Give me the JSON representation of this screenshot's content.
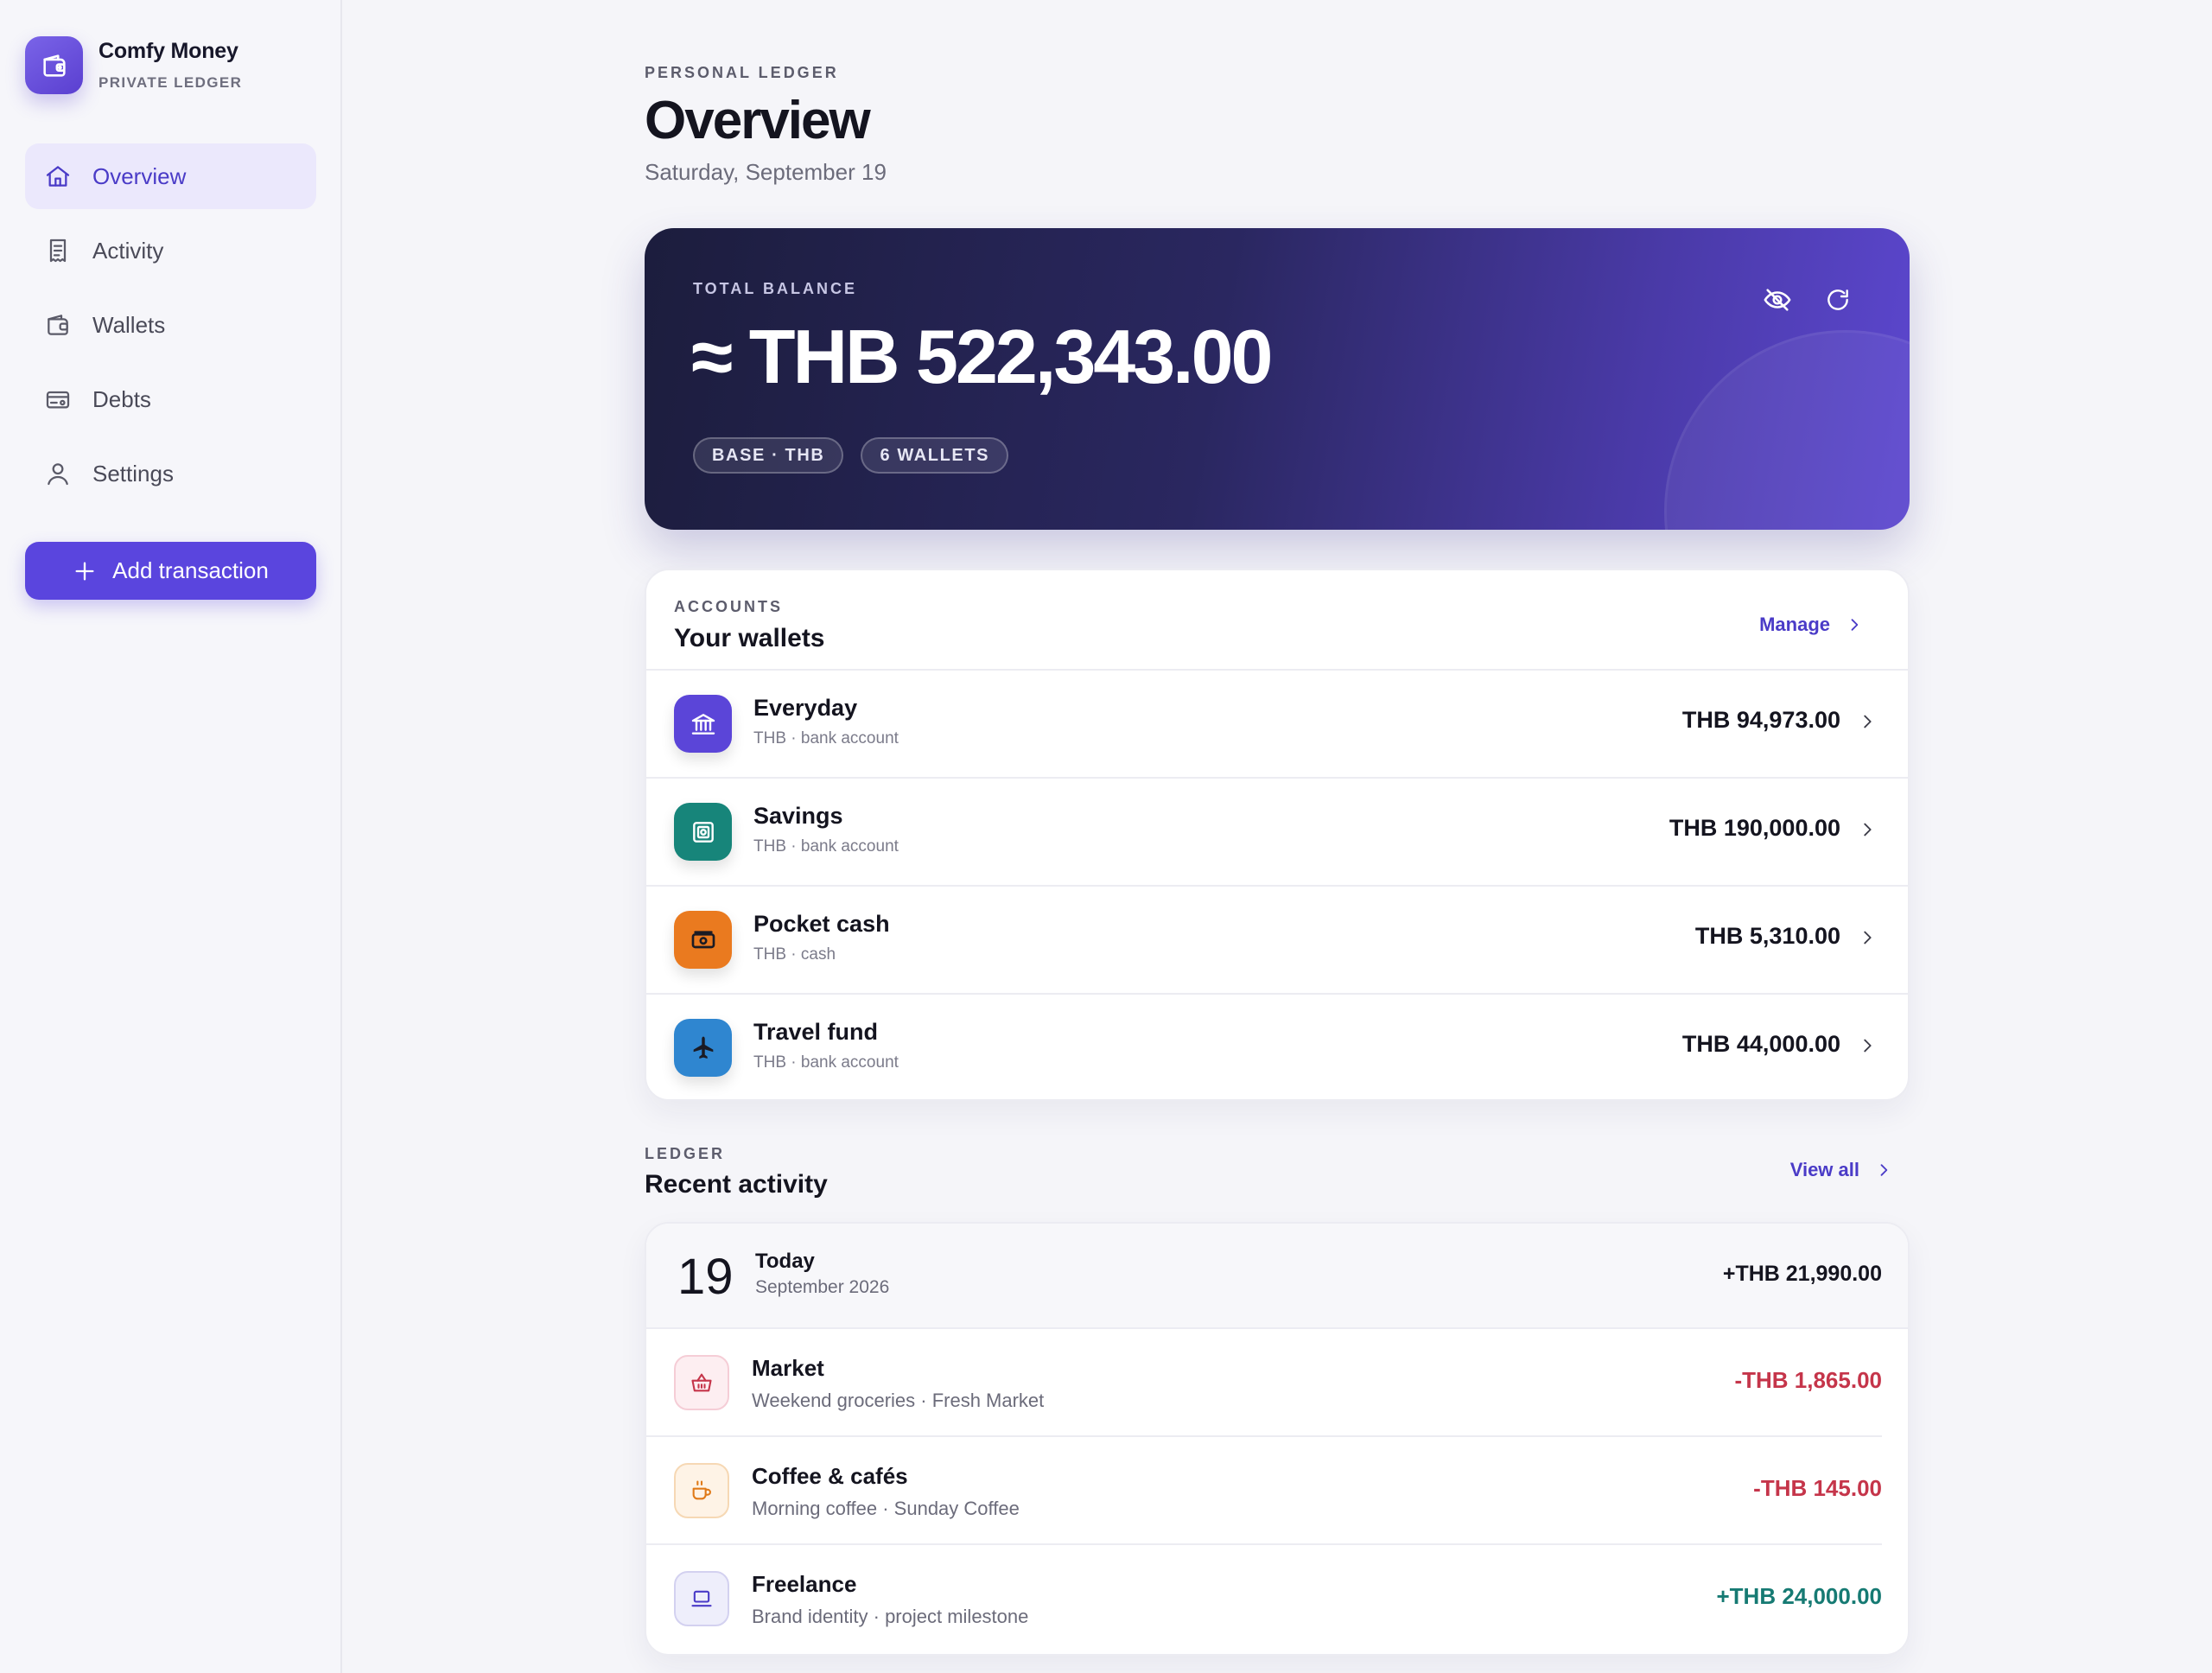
{
  "brand": {
    "name": "Comfy Money",
    "subtitle": "PRIVATE LEDGER",
    "icon": "wallet-icon"
  },
  "nav": [
    {
      "label": "Overview",
      "icon": "home-icon",
      "active": true
    },
    {
      "label": "Activity",
      "icon": "receipt-icon",
      "active": false
    },
    {
      "label": "Wallets",
      "icon": "wallet-icon",
      "active": false
    },
    {
      "label": "Debts",
      "icon": "card-icon",
      "active": false
    },
    {
      "label": "Settings",
      "icon": "user-icon",
      "active": false
    }
  ],
  "add_button": {
    "label": "Add transaction",
    "icon": "plus-icon"
  },
  "page": {
    "eyebrow": "PERSONAL LEDGER",
    "title": "Overview",
    "date": "Saturday, September 19"
  },
  "balance": {
    "eyebrow": "TOTAL BALANCE",
    "amount": "≈ THB 522,343.00",
    "chips": [
      "BASE · THB",
      "6 WALLETS"
    ],
    "icons": [
      "eye-off-icon",
      "refresh-icon"
    ]
  },
  "wallets": {
    "eyebrow": "ACCOUNTS",
    "title": "Your wallets",
    "manage_label": "Manage",
    "items": [
      {
        "name": "Everyday",
        "meta": "THB · bank account",
        "amount": "THB 94,973.00",
        "icon": "bank-icon",
        "color": "#5b45d8"
      },
      {
        "name": "Savings",
        "meta": "THB · bank account",
        "amount": "THB 190,000.00",
        "icon": "safe-icon",
        "color": "#17857a"
      },
      {
        "name": "Pocket cash",
        "meta": "THB · cash",
        "amount": "THB 5,310.00",
        "icon": "cash-icon",
        "color": "#ea7a1f"
      },
      {
        "name": "Travel fund",
        "meta": "THB · bank account",
        "amount": "THB 44,000.00",
        "icon": "plane-icon",
        "color": "#2f86d0"
      }
    ]
  },
  "ledger": {
    "eyebrow": "LEDGER",
    "title": "Recent activity",
    "view_all_label": "View all",
    "day": {
      "number": "19",
      "label": "Today",
      "month": "September 2026",
      "total": "+THB 21,990.00"
    },
    "transactions": [
      {
        "name": "Market",
        "meta": "Weekend groceries · Fresh Market",
        "amount": "-THB 1,865.00",
        "icon": "basket-icon",
        "tone": "negative"
      },
      {
        "name": "Coffee & cafés",
        "meta": "Morning coffee · Sunday Coffee",
        "amount": "-THB 145.00",
        "icon": "coffee-icon",
        "tone": "negative"
      },
      {
        "name": "Freelance",
        "meta": "Brand identity · project milestone",
        "amount": "+THB 24,000.00",
        "icon": "laptop-icon",
        "tone": "positive"
      }
    ]
  },
  "colors": {
    "accent": "#5a45de",
    "negative": "#c5354a",
    "positive": "#167a73"
  }
}
